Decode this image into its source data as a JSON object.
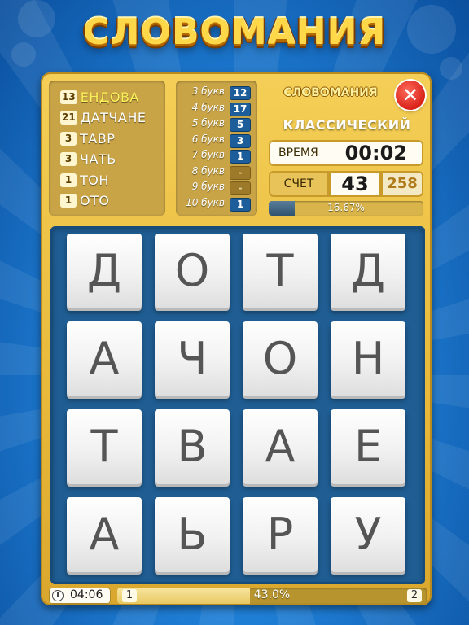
{
  "game": {
    "title": "СЛОВОМАНИЯ",
    "mini_title": "СЛОВОМАНИЯ",
    "mode": "КЛАССИЧЕСКИЙ",
    "close_symbol": "✕"
  },
  "found_words": [
    {
      "count": "13",
      "word": "ЕНДОВА",
      "latest": true
    },
    {
      "count": "21",
      "word": "ДАТЧАНЕ",
      "latest": false
    },
    {
      "count": "3",
      "word": "ТАВР",
      "latest": false
    },
    {
      "count": "3",
      "word": "ЧАТЬ",
      "latest": false
    },
    {
      "count": "1",
      "word": "ТОН",
      "latest": false
    },
    {
      "count": "1",
      "word": "ОТО",
      "latest": false
    }
  ],
  "letter_stats": [
    {
      "label": "3 букв",
      "value": "12"
    },
    {
      "label": "4 букв",
      "value": "17"
    },
    {
      "label": "5 букв",
      "value": "5"
    },
    {
      "label": "6 букв",
      "value": "3"
    },
    {
      "label": "7 букв",
      "value": "1"
    },
    {
      "label": "8 букв",
      "value": "-"
    },
    {
      "label": "9 букв",
      "value": "-"
    },
    {
      "label": "10 букв",
      "value": "1"
    }
  ],
  "time": {
    "label": "ВРЕМЯ",
    "value": "00:02"
  },
  "score": {
    "label": "СЧЕТ",
    "value": "43",
    "max": "258"
  },
  "progress": {
    "text": "16.67%",
    "fraction": 0.1667
  },
  "board": {
    "rows": [
      [
        "Д",
        "О",
        "Т",
        "Д"
      ],
      [
        "А",
        "Ч",
        "О",
        "Н"
      ],
      [
        "Т",
        "В",
        "А",
        "Е"
      ],
      [
        "А",
        "Ь",
        "Р",
        "У"
      ]
    ]
  },
  "bottom": {
    "clock": "04:06",
    "level_from": "1",
    "level_to": "2",
    "level_progress_text": "43.0%",
    "level_fraction": 0.43
  },
  "colors": {
    "panel_gold": "#e8b93a",
    "board_blue": "#1f5d92",
    "stat_blue": "#1d5d99",
    "close_red": "#d9231a",
    "latest_word": "#fff35a"
  }
}
